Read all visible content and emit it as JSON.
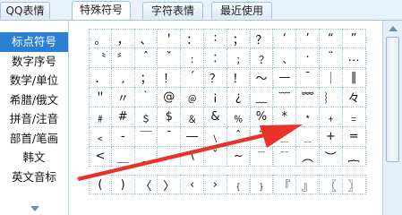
{
  "tabs": [
    {
      "label": "QQ表情"
    },
    {
      "label": "特殊符号"
    },
    {
      "label": "字符表情"
    },
    {
      "label": "最近使用"
    }
  ],
  "sidebar": {
    "items": [
      {
        "label": "标点符号"
      },
      {
        "label": "数字序号"
      },
      {
        "label": "数学/单位"
      },
      {
        "label": "希腊/俄文"
      },
      {
        "label": "拼音/注音"
      },
      {
        "label": "部首/笔画"
      },
      {
        "label": "韩文"
      },
      {
        "label": "英文音标"
      }
    ]
  },
  "symbols": {
    "rows": [
      [
        "。",
        "，",
        "、",
        "＇",
        "：",
        "∶",
        "；",
        "？",
        "‘",
        "’",
        "“",
        "”"
      ],
      [
        "〝",
        "〞",
        "ˆ",
        "ˇ",
        "﹕",
        "︰",
        "﹔",
        "﹖",
        "﹑",
        "·",
        "¨",
        "…"
      ],
      [
        "．",
        "¸",
        "；",
        "！",
        "´",
        "？",
        "！",
        "～",
        "—",
        "ˉ",
        "｜",
        "‖"
      ],
      [
        "＂",
        "〃",
        "｀",
        "@",
        "﹫",
        "¡",
        "¿",
        "﹏",
        "﹋",
        "﹌",
        "︴",
        "々"
      ],
      [
        "﹟",
        "#",
        "﹩",
        "$",
        "﹠",
        "&",
        "﹪",
        "%",
        "*",
        "﹡",
        "﹢",
        "﹦"
      ],
      [
        "﹤",
        "‐",
        "￣",
        "¯",
        "―",
        "﹨",
        "ˆ",
        "˜",
        "﹍",
        "﹎",
        "+",
        "="
      ],
      [
        "<",
        "＿",
        "_",
        "-",
        "\\",
        "ˇ",
        "~",
        "﹉",
        "﹊",
        "︵",
        "︶",
        "︷"
      ]
    ],
    "bottom_row": [
      "(",
      ")",
      "〈",
      "〉",
      "‹",
      "›",
      "﹛",
      "﹜",
      "『",
      "』",
      "〖",
      "〗"
    ]
  }
}
